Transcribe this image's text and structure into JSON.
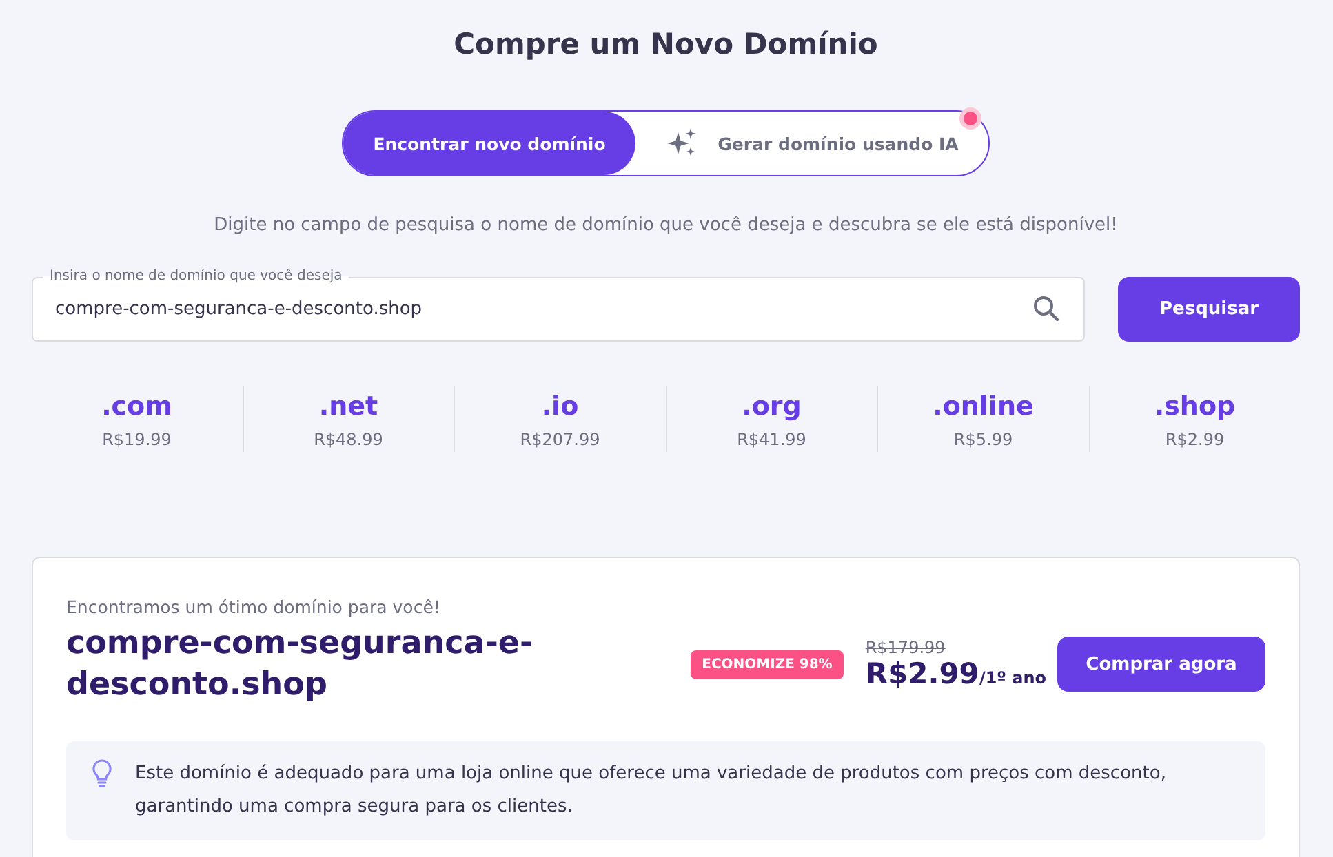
{
  "title": "Compre um Novo Domínio",
  "tabs": [
    {
      "label": "Encontrar novo domínio",
      "selected": true,
      "notification_dot": false
    },
    {
      "label": "Gerar domínio usando IA",
      "selected": false,
      "notification_dot": true
    }
  ],
  "subtitle": "Digite no campo de pesquisa o nome de domínio que você deseja e descubra se ele está disponível!",
  "search": {
    "label": "Insira o nome de domínio que você deseja",
    "value": "compre-com-seguranca-e-desconto.shop",
    "button": "Pesquisar"
  },
  "tlds": [
    {
      "name": ".com",
      "price": "R$19.99"
    },
    {
      "name": ".net",
      "price": "R$48.99"
    },
    {
      "name": ".io",
      "price": "R$207.99"
    },
    {
      "name": ".org",
      "price": "R$41.99"
    },
    {
      "name": ".online",
      "price": "R$5.99"
    },
    {
      "name": ".shop",
      "price": "R$2.99"
    }
  ],
  "result": {
    "intro": "Encontramos um ótimo domínio para você!",
    "domain": "compre-com-seguranca-e-desconto.shop",
    "badge": "ECONOMIZE 98%",
    "old_price": "R$179.99",
    "price": "R$2.99",
    "period": "/1º ano",
    "button": "Comprar agora",
    "hint": "Este domínio é adequado para uma loja online que oferece uma variedade de produtos com preços com desconto, garantindo uma compra segura para os clientes."
  }
}
